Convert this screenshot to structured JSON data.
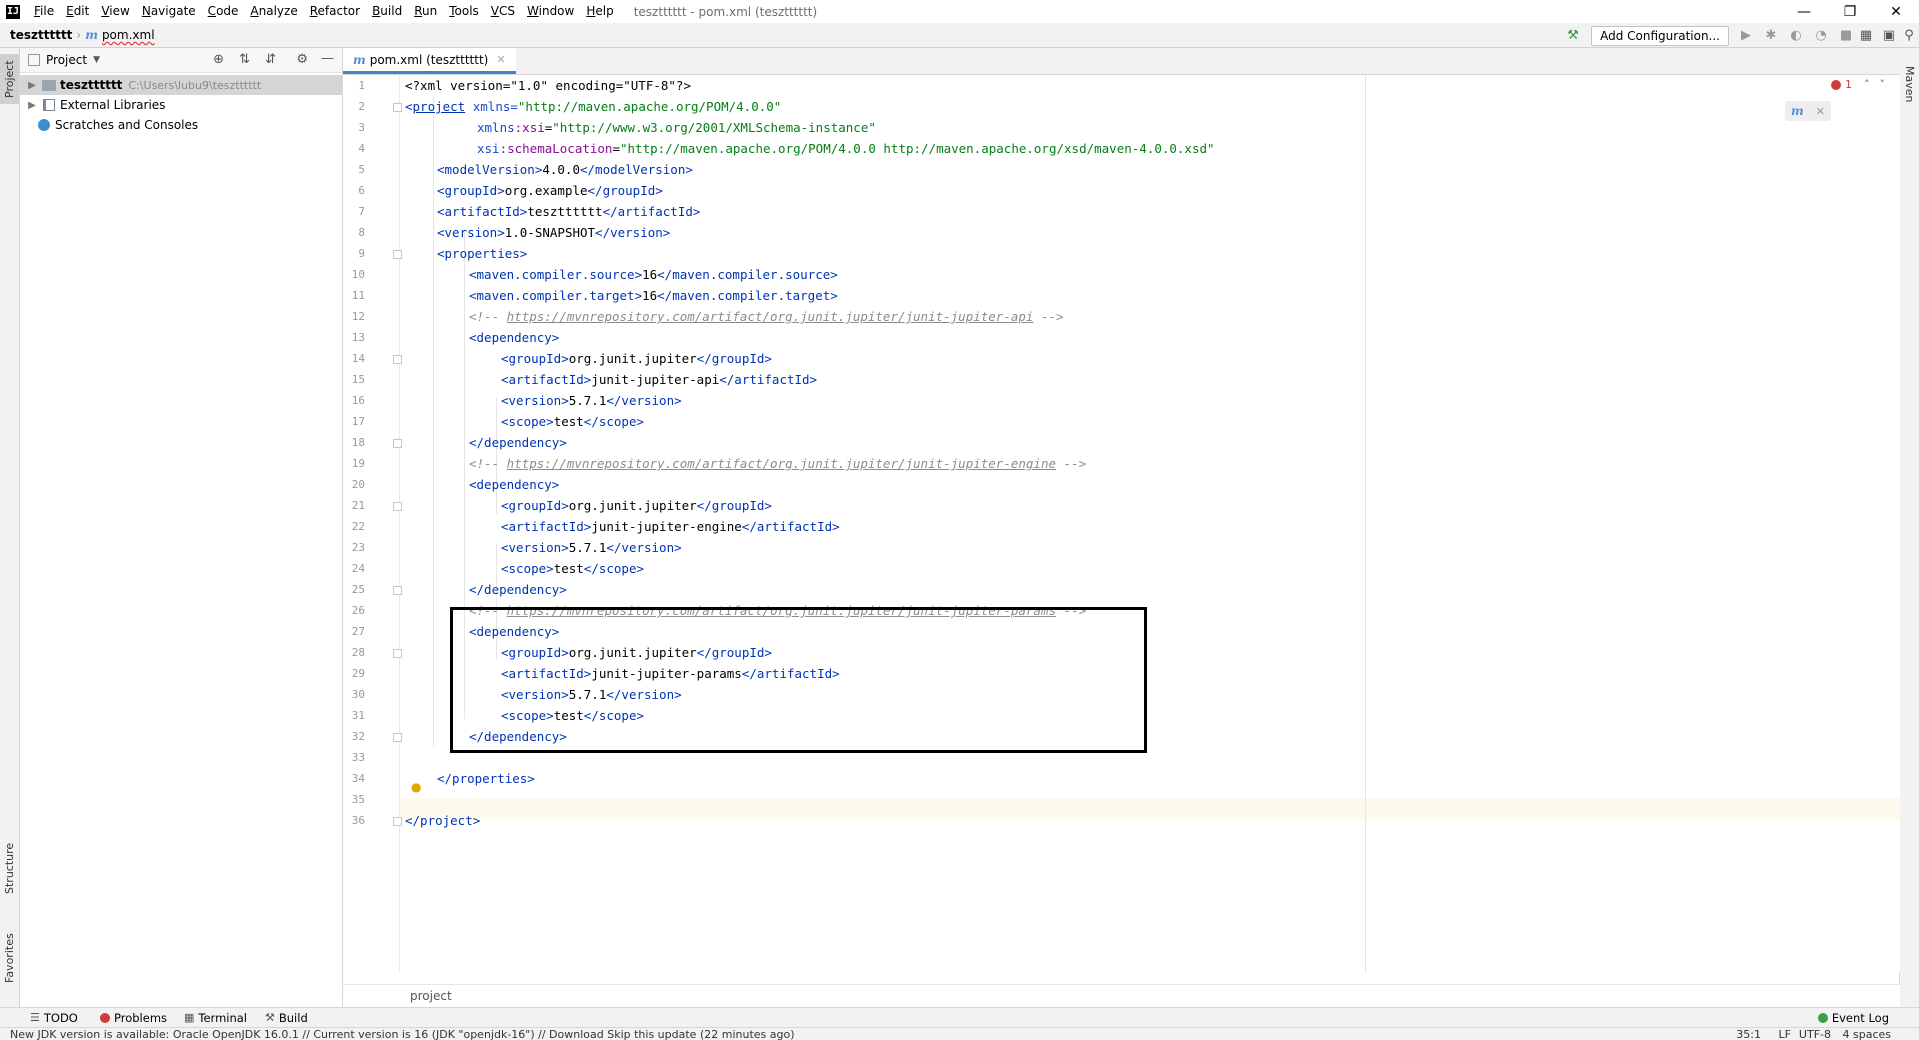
{
  "app": {
    "logo": "IJ",
    "window_title": "tesztttttt - pom.xml (tesztttttt)"
  },
  "menu": [
    "File",
    "Edit",
    "View",
    "Navigate",
    "Code",
    "Analyze",
    "Refactor",
    "Build",
    "Run",
    "Tools",
    "VCS",
    "Window",
    "Help"
  ],
  "navbar": {
    "project": "tesztttttt",
    "file": "pom.xml",
    "add_configuration": "Add Configuration..."
  },
  "project_panel": {
    "title": "Project",
    "side_tab": "Project",
    "tree": [
      {
        "label": "tesztttttt",
        "path": "C:\\Users\\lubu9\\tesztttttt"
      },
      {
        "label": "External Libraries"
      },
      {
        "label": "Scratches and Consoles"
      }
    ]
  },
  "editor": {
    "tab_label": "pom.xml (tesztttttt)",
    "error_count": "1",
    "breadcrumb": "project",
    "lines": [
      "1",
      "2",
      "3",
      "4",
      "5",
      "6",
      "7",
      "8",
      "9",
      "10",
      "11",
      "12",
      "13",
      "14",
      "15",
      "16",
      "17",
      "18",
      "19",
      "20",
      "21",
      "22",
      "23",
      "24",
      "25",
      "26",
      "27",
      "28",
      "29",
      "30",
      "31",
      "32",
      "33",
      "34",
      "35",
      "36"
    ],
    "code": {
      "l1": "<?xml version=\"1.0\" encoding=\"UTF-8\"?>",
      "l2_tag": "project",
      "l2_attr": " xmlns=",
      "l2_val": "\"http://maven.apache.org/POM/4.0.0\"",
      "l3_val": "\"http://www.w3.org/2001/XMLSchema-instance\"",
      "l4_val": "\"http://maven.apache.org/POM/4.0.0 http://maven.apache.org/xsd/maven-4.0.0.xsd\"",
      "modelVersion": "4.0.0",
      "groupId": "org.example",
      "artifactId": "tesztttttt",
      "version": "1.0-SNAPSHOT",
      "source": "16",
      "target": "16",
      "c1_url": "https://mvnrepository.com/artifact/org.junit.jupiter/junit-jupiter-api",
      "c2_url": "https://mvnrepository.com/artifact/org.junit.jupiter/junit-jupiter-engine",
      "c3_url": "https://mvnrepository.com/artifact/org.junit.jupiter/junit-jupiter-params",
      "dep_group": "org.junit.jupiter",
      "dep1_artifact": "junit-jupiter-api",
      "dep2_artifact": "junit-jupiter-engine",
      "dep3_artifact": "junit-jupiter-params",
      "dep_version": "5.7.1",
      "dep_scope": "test"
    }
  },
  "side_tabs": {
    "structure": "Structure",
    "favorites": "Favorites",
    "maven": "Maven"
  },
  "bottom_tabs": [
    "TODO",
    "Problems",
    "Terminal",
    "Build"
  ],
  "event_log": "Event Log",
  "status": {
    "message": "New JDK version is available: Oracle OpenJDK 16.0.1 // Current version is 16 (JDK \"openjdk-16\") // Download   Skip this update (22 minutes ago)",
    "position": "35:1",
    "line_sep": "LF",
    "encoding": "UTF-8",
    "indent": "4 spaces"
  }
}
